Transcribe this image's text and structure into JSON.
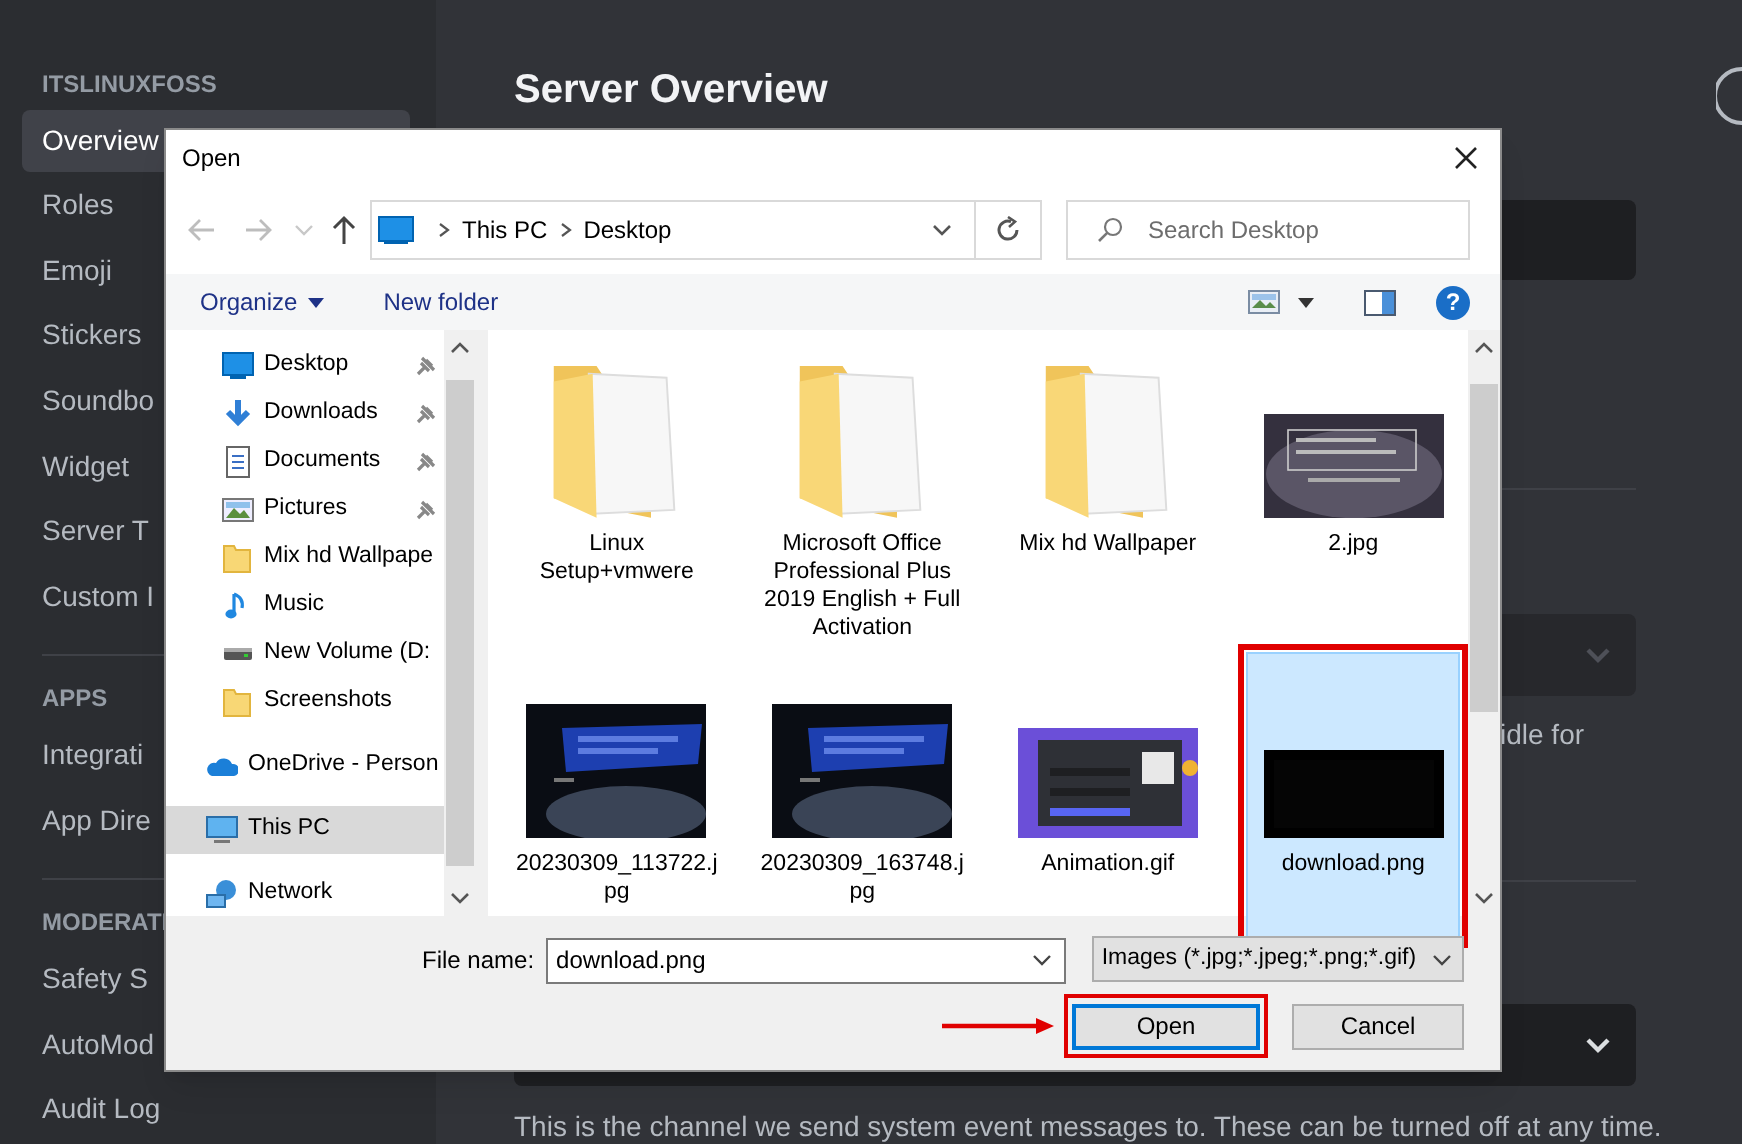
{
  "sidebar": {
    "groups": [
      {
        "header": "ITSLINUXFOSS",
        "items": [
          {
            "label": "Overview",
            "selected": true
          },
          {
            "label": "Roles",
            "selected": false
          },
          {
            "label": "Emoji",
            "selected": false
          },
          {
            "label": "Stickers",
            "selected": false
          },
          {
            "label": "Soundbo",
            "selected": false
          },
          {
            "label": "Widget",
            "selected": false
          },
          {
            "label": "Server T",
            "selected": false
          },
          {
            "label": "Custom I",
            "selected": false
          }
        ]
      },
      {
        "header": "APPS",
        "items": [
          {
            "label": "Integrati",
            "selected": false
          },
          {
            "label": "App Dire",
            "selected": false
          }
        ]
      },
      {
        "header": "MODERATI",
        "items": [
          {
            "label": "Safety S",
            "selected": false
          },
          {
            "label": "AutoMod",
            "selected": false
          },
          {
            "label": "Audit Log",
            "selected": false
          }
        ]
      }
    ]
  },
  "main": {
    "title": "Server Overview",
    "idle_text": "idle for",
    "system_channel_hint": "This is the channel we send system event messages to. These can be turned off at any time."
  },
  "dialog": {
    "title": "Open",
    "path": [
      "This PC",
      "Desktop"
    ],
    "search_placeholder": "Search Desktop",
    "toolbar": {
      "organize": "Organize",
      "new_folder": "New folder",
      "help": "?"
    },
    "quick_access": [
      {
        "label": "Desktop",
        "kind": "desktop",
        "pinned": true
      },
      {
        "label": "Downloads",
        "kind": "download",
        "pinned": true
      },
      {
        "label": "Documents",
        "kind": "document",
        "pinned": true
      },
      {
        "label": "Pictures",
        "kind": "pictures",
        "pinned": true
      },
      {
        "label": "Mix hd Wallpape",
        "kind": "folder",
        "pinned": false
      },
      {
        "label": "Music",
        "kind": "music",
        "pinned": false
      },
      {
        "label": "New Volume (D:",
        "kind": "drive",
        "pinned": false
      },
      {
        "label": "Screenshots",
        "kind": "folder",
        "pinned": false
      }
    ],
    "locations": [
      {
        "label": "OneDrive - Person",
        "kind": "cloud",
        "selected": false
      },
      {
        "label": "This PC",
        "kind": "computer",
        "selected": true
      },
      {
        "label": "Network",
        "kind": "network",
        "selected": false
      }
    ],
    "files": [
      {
        "name": "Linux Setup+vmwere",
        "kind": "folder",
        "selected": false,
        "annotated": false
      },
      {
        "name": "Microsoft Office Professional Plus 2019  English + Full Activation",
        "kind": "folder",
        "selected": false,
        "annotated": false
      },
      {
        "name": "Mix hd Wallpaper",
        "kind": "folder",
        "selected": false,
        "annotated": false
      },
      {
        "name": "2.jpg",
        "kind": "terminal-image",
        "selected": false,
        "annotated": false
      },
      {
        "name": "20230309_113722.jpg",
        "selected": false,
        "annotated": false
      },
      {
        "name": "20230309_163748.jpg",
        "selected": false,
        "annotated": false
      },
      {
        "name": "Animation.gif",
        "kind": "app-image",
        "selected": false,
        "annotated": false
      },
      {
        "name": "download.png",
        "kind": "black-image",
        "selected": true,
        "annotated": true
      }
    ],
    "file_name_label": "File name:",
    "file_name": "download.png",
    "file_type": "Images (*.jpg;*.jpeg;*.png;*.gif)",
    "buttons": [
      {
        "label": "Open",
        "kind": "primary",
        "annotated": true
      },
      {
        "label": "Cancel",
        "kind": "secondary",
        "annotated": false
      }
    ]
  }
}
